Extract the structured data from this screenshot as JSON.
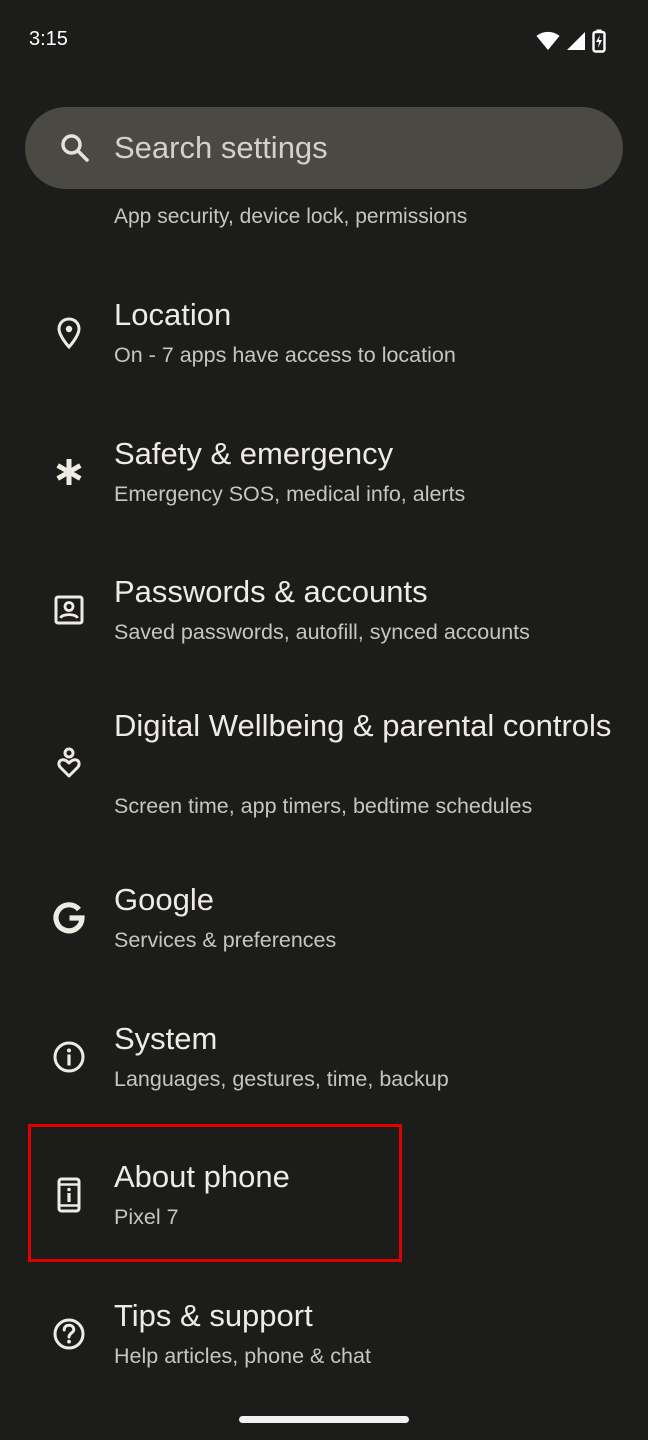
{
  "status_bar": {
    "time": "3:15",
    "icons": [
      "wifi-icon",
      "cellular-signal-icon",
      "battery-charging-icon"
    ]
  },
  "search": {
    "placeholder": "Search settings",
    "icon": "search-icon"
  },
  "clipped_item": {
    "subtitle": "App security, device lock, permissions"
  },
  "settings_items": [
    {
      "id": "location",
      "title": "Location",
      "subtitle": "On - 7 apps have access to location",
      "icon": "location-pin-icon"
    },
    {
      "id": "safety",
      "title": "Safety & emergency",
      "subtitle": "Emergency SOS, medical info, alerts",
      "icon": "asterisk-icon"
    },
    {
      "id": "passwords",
      "title": "Passwords & accounts",
      "subtitle": "Saved passwords, autofill, synced accounts",
      "icon": "account-box-icon"
    },
    {
      "id": "wellbeing",
      "title": "Digital Wellbeing & parental controls",
      "subtitle": "Screen time, app timers, bedtime schedules",
      "icon": "wellbeing-icon"
    },
    {
      "id": "google",
      "title": "Google",
      "subtitle": "Services & preferences",
      "icon": "google-g-icon"
    },
    {
      "id": "system",
      "title": "System",
      "subtitle": "Languages, gestures, time, backup",
      "icon": "info-circle-icon"
    },
    {
      "id": "about",
      "title": "About phone",
      "subtitle": "Pixel 7",
      "icon": "phone-info-icon",
      "highlighted": true
    },
    {
      "id": "tips",
      "title": "Tips & support",
      "subtitle": "Help articles, phone & chat",
      "icon": "help-circle-icon"
    }
  ],
  "colors": {
    "background": "#1c1c1a",
    "search_bar": "#4a4944",
    "highlight": "#e00000"
  }
}
